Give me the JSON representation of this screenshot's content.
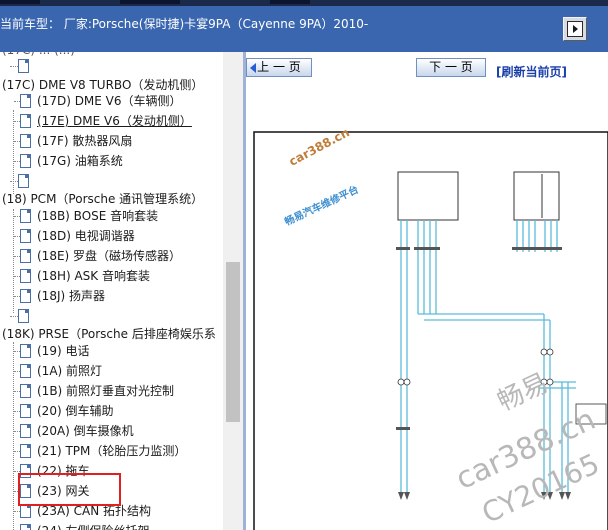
{
  "window": {
    "car_model_text": "当前车型：   厂家:Porsche(保时捷)卡宴9PA（Cayenne 9PA）2010-"
  },
  "tree": {
    "partial_top": "(17C) ... (...)",
    "items": [
      {
        "label": "(17C) DME V8 TURBO（发动机侧）",
        "level": 0,
        "expanded": true
      },
      {
        "label": "(17D) DME V6（车辆侧）",
        "level": 1
      },
      {
        "label": "(17E) DME V6（发动机侧）",
        "level": 1,
        "underlined": true
      },
      {
        "label": "(17F) 散热器风扇",
        "level": 1
      },
      {
        "label": "(17G) 油箱系统",
        "level": 1
      },
      {
        "label": "(18) PCM（Porsche 通讯管理系统）",
        "level": 0,
        "expanded": true
      },
      {
        "label": "(18B) BOSE 音响套装",
        "level": 1
      },
      {
        "label": "(18D) 电视调谐器",
        "level": 1
      },
      {
        "label": "(18E) 罗盘（磁场传感器）",
        "level": 1
      },
      {
        "label": "(18H) ASK 音响套装",
        "level": 1
      },
      {
        "label": "(18J) 扬声器",
        "level": 1
      },
      {
        "label": "(18K) PRSE（Porsche 后排座椅娱乐系",
        "level": 0,
        "expanded": true
      },
      {
        "label": "(19) 电话",
        "level": 1
      },
      {
        "label": "(1A) 前照灯",
        "level": 1
      },
      {
        "label": "(1B) 前照灯垂直对光控制",
        "level": 1
      },
      {
        "label": "(20) 倒车辅助",
        "level": 1
      },
      {
        "label": "(20A) 倒车摄像机",
        "level": 1
      },
      {
        "label": "(21) TPM（轮胎压力监测）",
        "level": 1
      },
      {
        "label": "(22) 拖车",
        "level": 1
      },
      {
        "label": "(23) 网关",
        "level": 1,
        "highlighted": true
      },
      {
        "label": "(23A) CAN 拓扑结构",
        "level": 1
      },
      {
        "label": "(24) 左侧保险丝托架",
        "level": 1
      }
    ]
  },
  "nav": {
    "prev_label": "上 一 页",
    "next_label": "下 一 页",
    "refresh_label": "[刷新当前页]"
  },
  "diagram": {
    "watermark_site": "car388.cn",
    "watermark_platform": "畅易汽车维修平台",
    "watermark_brand": "畅易",
    "watermark_site_large": "car388.cn",
    "watermark_code": "CY20165"
  }
}
